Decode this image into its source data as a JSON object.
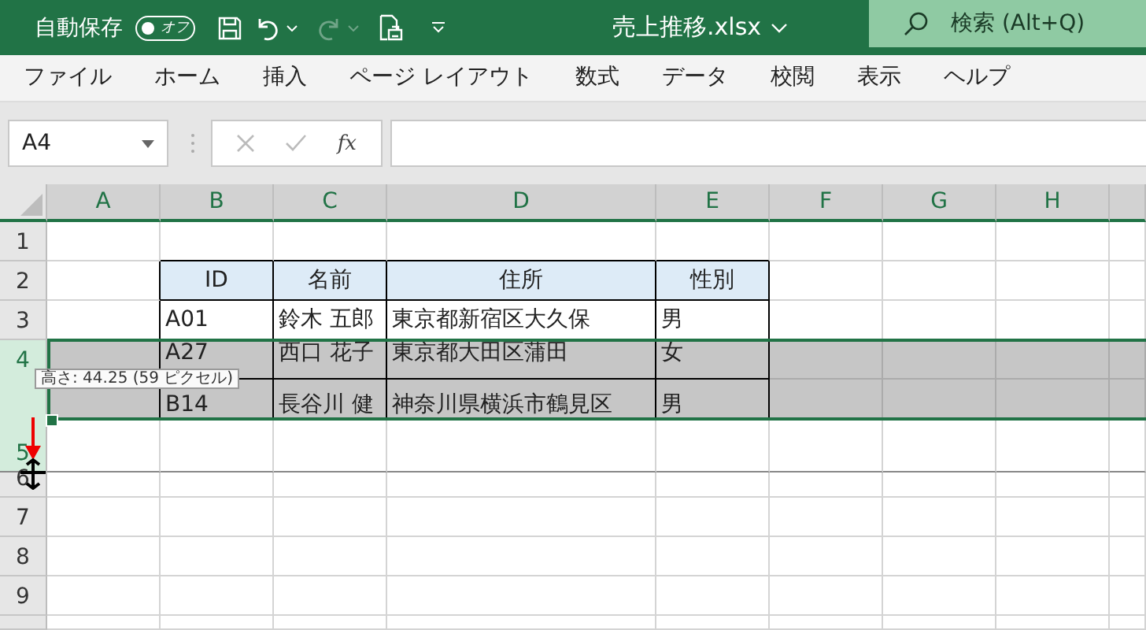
{
  "title_bar": {
    "autosave_label": "自動保存",
    "autosave": {
      "on": false,
      "label": "オフ"
    },
    "redo_disabled": true,
    "filename": "売上推移.xlsx",
    "search": {
      "placeholder": "検索 (Alt+Q)"
    }
  },
  "ribbon_tabs": [
    {
      "label": "ファイル",
      "selected": false
    },
    {
      "label": "ホーム",
      "selected": false
    },
    {
      "label": "挿入",
      "selected": false
    },
    {
      "label": "ページ レイアウト",
      "selected": false
    },
    {
      "label": "数式",
      "selected": false
    },
    {
      "label": "データ",
      "selected": false
    },
    {
      "label": "校閲",
      "selected": false
    },
    {
      "label": "表示",
      "selected": false
    },
    {
      "label": "ヘルプ",
      "selected": false
    }
  ],
  "formula_bar": {
    "name_box": "A4",
    "function_label": "fx"
  },
  "sheet": {
    "columns": [
      "A",
      "B",
      "C",
      "D",
      "E",
      "F",
      "G",
      "H"
    ],
    "rows": [
      {
        "header": "1",
        "kind": "blank",
        "selected": false,
        "resizing": false,
        "cells": [
          "",
          "",
          "",
          "",
          "",
          "",
          "",
          ""
        ]
      },
      {
        "header": "2",
        "kind": "table_head",
        "selected": false,
        "resizing": false,
        "cells": [
          "",
          "ID",
          "名前",
          "住所",
          "性別",
          "",
          "",
          ""
        ]
      },
      {
        "header": "3",
        "kind": "table_row",
        "selected": false,
        "resizing": false,
        "cells": [
          "",
          "A01",
          "鈴木 五郎",
          "東京都新宿区大久保",
          "男",
          "",
          "",
          ""
        ]
      },
      {
        "header": "4",
        "kind": "table_row",
        "selected": true,
        "resizing": false,
        "cells": [
          "",
          "A27",
          "西口 花子",
          "東京都大田区蒲田",
          "女",
          "",
          "",
          ""
        ]
      },
      {
        "kind": "table_row",
        "selected": true,
        "resizing": false,
        "cells": [
          "",
          "B14",
          "長谷川 健",
          "神奈川県横浜市鶴見区",
          "男",
          "",
          "",
          ""
        ]
      },
      {
        "header": "5",
        "kind": "blank",
        "selected": false,
        "resizing": true,
        "cells": [
          "",
          "",
          "",
          "",
          "",
          "",
          "",
          ""
        ]
      },
      {
        "header": "6",
        "kind": "blank",
        "selected": false,
        "resizing": false,
        "cells": [
          "",
          "",
          "",
          "",
          "",
          "",
          "",
          ""
        ]
      },
      {
        "header": "7",
        "kind": "blank",
        "selected": false,
        "resizing": false,
        "cells": [
          "",
          "",
          "",
          "",
          "",
          "",
          "",
          ""
        ]
      },
      {
        "header": "8",
        "kind": "blank",
        "selected": false,
        "resizing": false,
        "cells": [
          "",
          "",
          "",
          "",
          "",
          "",
          "",
          ""
        ]
      },
      {
        "header": "9",
        "kind": "blank",
        "selected": false,
        "resizing": false,
        "cells": [
          "",
          "",
          "",
          "",
          "",
          "",
          "",
          ""
        ]
      }
    ]
  },
  "tooltip": "高さ: 44.25 (59 ピクセル)"
}
